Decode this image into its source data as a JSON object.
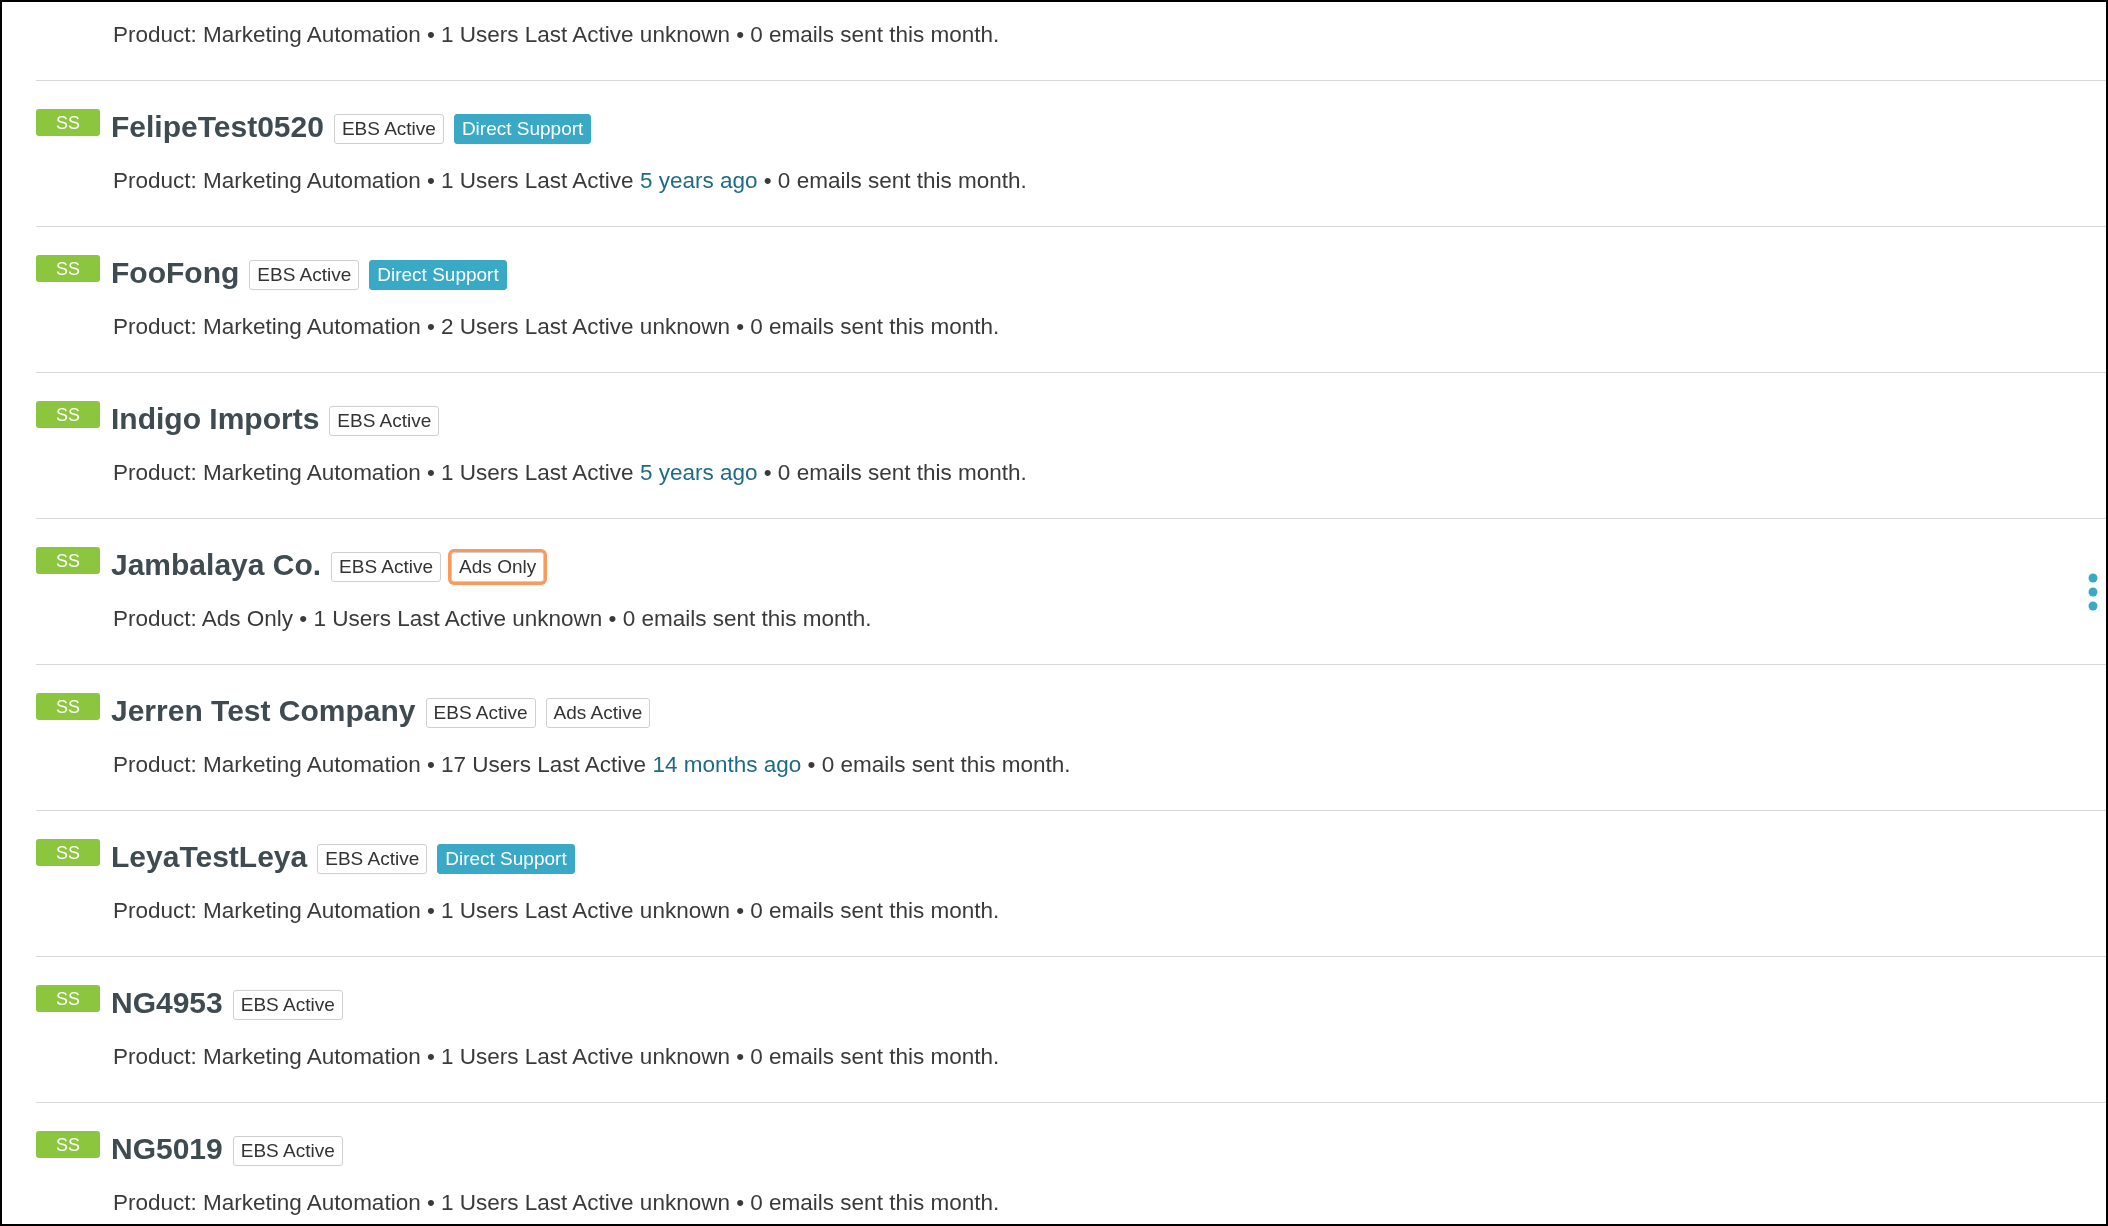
{
  "top_partial": {
    "parts": [
      {
        "kind": "text",
        "text": "Product: Marketing Automation • 1 Users Last Active unknown • 0 emails sent this month."
      }
    ]
  },
  "accounts": [
    {
      "badge": "SS",
      "name": "FelipeTest0520",
      "menu_visible": false,
      "tags": [
        {
          "label": "EBS Active",
          "kind": "outline",
          "highlighted": false
        },
        {
          "label": "Direct Support",
          "kind": "filled",
          "highlighted": false
        }
      ],
      "parts": [
        {
          "kind": "text",
          "text": "Product: Marketing Automation • 1 Users Last Active"
        },
        {
          "kind": "link",
          "text": "5 years ago"
        },
        {
          "kind": "text",
          "text": "• 0 emails sent this month."
        }
      ]
    },
    {
      "badge": "SS",
      "name": "FooFong",
      "menu_visible": false,
      "tags": [
        {
          "label": "EBS Active",
          "kind": "outline",
          "highlighted": false
        },
        {
          "label": "Direct Support",
          "kind": "filled",
          "highlighted": false
        }
      ],
      "parts": [
        {
          "kind": "text",
          "text": "Product: Marketing Automation • 2 Users Last Active unknown • 0 emails sent this month."
        }
      ]
    },
    {
      "badge": "SS",
      "name": "Indigo Imports",
      "menu_visible": false,
      "tags": [
        {
          "label": "EBS Active",
          "kind": "outline",
          "highlighted": false
        }
      ],
      "parts": [
        {
          "kind": "text",
          "text": "Product: Marketing Automation • 1 Users Last Active"
        },
        {
          "kind": "link",
          "text": "5 years ago"
        },
        {
          "kind": "text",
          "text": "• 0 emails sent this month."
        }
      ]
    },
    {
      "badge": "SS",
      "name": "Jambalaya Co.",
      "menu_visible": true,
      "tags": [
        {
          "label": "EBS Active",
          "kind": "outline",
          "highlighted": false
        },
        {
          "label": "Ads Only",
          "kind": "outline",
          "highlighted": true
        }
      ],
      "parts": [
        {
          "kind": "text",
          "text": "Product: Ads Only • 1 Users Last Active unknown • 0 emails sent this month."
        }
      ]
    },
    {
      "badge": "SS",
      "name": "Jerren Test Company",
      "menu_visible": false,
      "tags": [
        {
          "label": "EBS Active",
          "kind": "outline",
          "highlighted": false
        },
        {
          "label": "Ads Active",
          "kind": "outline",
          "highlighted": false
        }
      ],
      "parts": [
        {
          "kind": "text",
          "text": "Product: Marketing Automation • 17 Users Last Active"
        },
        {
          "kind": "link",
          "text": "14 months ago"
        },
        {
          "kind": "text",
          "text": "• 0 emails sent this month."
        }
      ]
    },
    {
      "badge": "SS",
      "name": "LeyaTestLeya",
      "menu_visible": false,
      "tags": [
        {
          "label": "EBS Active",
          "kind": "outline",
          "highlighted": false
        },
        {
          "label": "Direct Support",
          "kind": "filled",
          "highlighted": false
        }
      ],
      "parts": [
        {
          "kind": "text",
          "text": "Product: Marketing Automation • 1 Users Last Active unknown • 0 emails sent this month."
        }
      ]
    },
    {
      "badge": "SS",
      "name": "NG4953",
      "menu_visible": false,
      "tags": [
        {
          "label": "EBS Active",
          "kind": "outline",
          "highlighted": false
        }
      ],
      "parts": [
        {
          "kind": "text",
          "text": "Product: Marketing Automation • 1 Users Last Active unknown • 0 emails sent this month."
        }
      ]
    },
    {
      "badge": "SS",
      "name": "NG5019",
      "menu_visible": false,
      "tags": [
        {
          "label": "EBS Active",
          "kind": "outline",
          "highlighted": false
        }
      ],
      "parts": [
        {
          "kind": "text",
          "text": "Product: Marketing Automation • 1 Users Last Active unknown • 0 emails sent this month."
        }
      ]
    }
  ]
}
